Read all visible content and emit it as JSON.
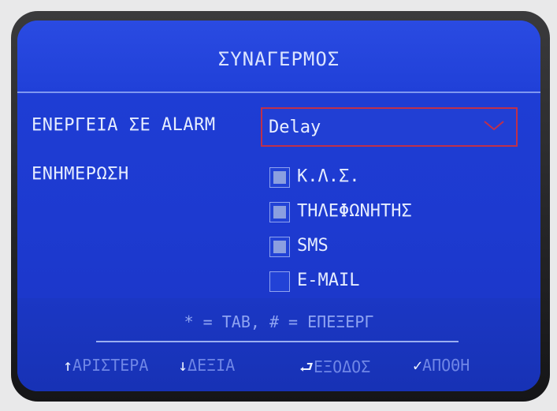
{
  "screen": {
    "title": "ΣΥΝΑΓΕΡΜΟΣ",
    "alarm_action": {
      "label": "ΕΝΕΡΓΕΙΑ ΣΕ ALARM",
      "selected_value": "Delay"
    },
    "notify": {
      "label": "ΕΝΗΜΕΡΩΣΗ",
      "options": [
        {
          "label": "Κ.Λ.Σ.",
          "checked": true
        },
        {
          "label": "ΤΗΛΕΦΩΝΗΤΗΣ",
          "checked": true
        },
        {
          "label": "SMS",
          "checked": true
        },
        {
          "label": "E-MAIL",
          "checked": false
        }
      ]
    },
    "hint": "* = TAB, # = ΕΠΕΞΕΡΓ",
    "softkeys": {
      "left": {
        "glyph": "↑",
        "label": "ΑΡΙΣΤΕΡΑ"
      },
      "right": {
        "glyph": "↓",
        "label": "ΔΕΞΙΑ"
      },
      "exit": {
        "glyph": "⮐",
        "label": "ΕΞΟΔΟΣ"
      },
      "save": {
        "glyph": "✓",
        "label": "ΑΠΟΘΗ"
      }
    }
  }
}
